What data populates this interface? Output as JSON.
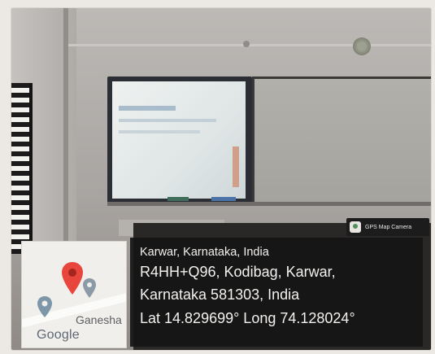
{
  "gps_badge": {
    "label": "GPS Map Camera",
    "icon": "gps-map-camera-icon"
  },
  "map": {
    "place_label": "Ganesha",
    "logo_text": "Google",
    "pin_color": "#e8453c"
  },
  "location": {
    "line1": "Karwar, Karnataka, India",
    "line2": "R4HH+Q96, Kodibag, Karwar,",
    "line3": "Karnataka 581303, India",
    "line4": "Lat 14.829699° Long 74.128024°"
  }
}
